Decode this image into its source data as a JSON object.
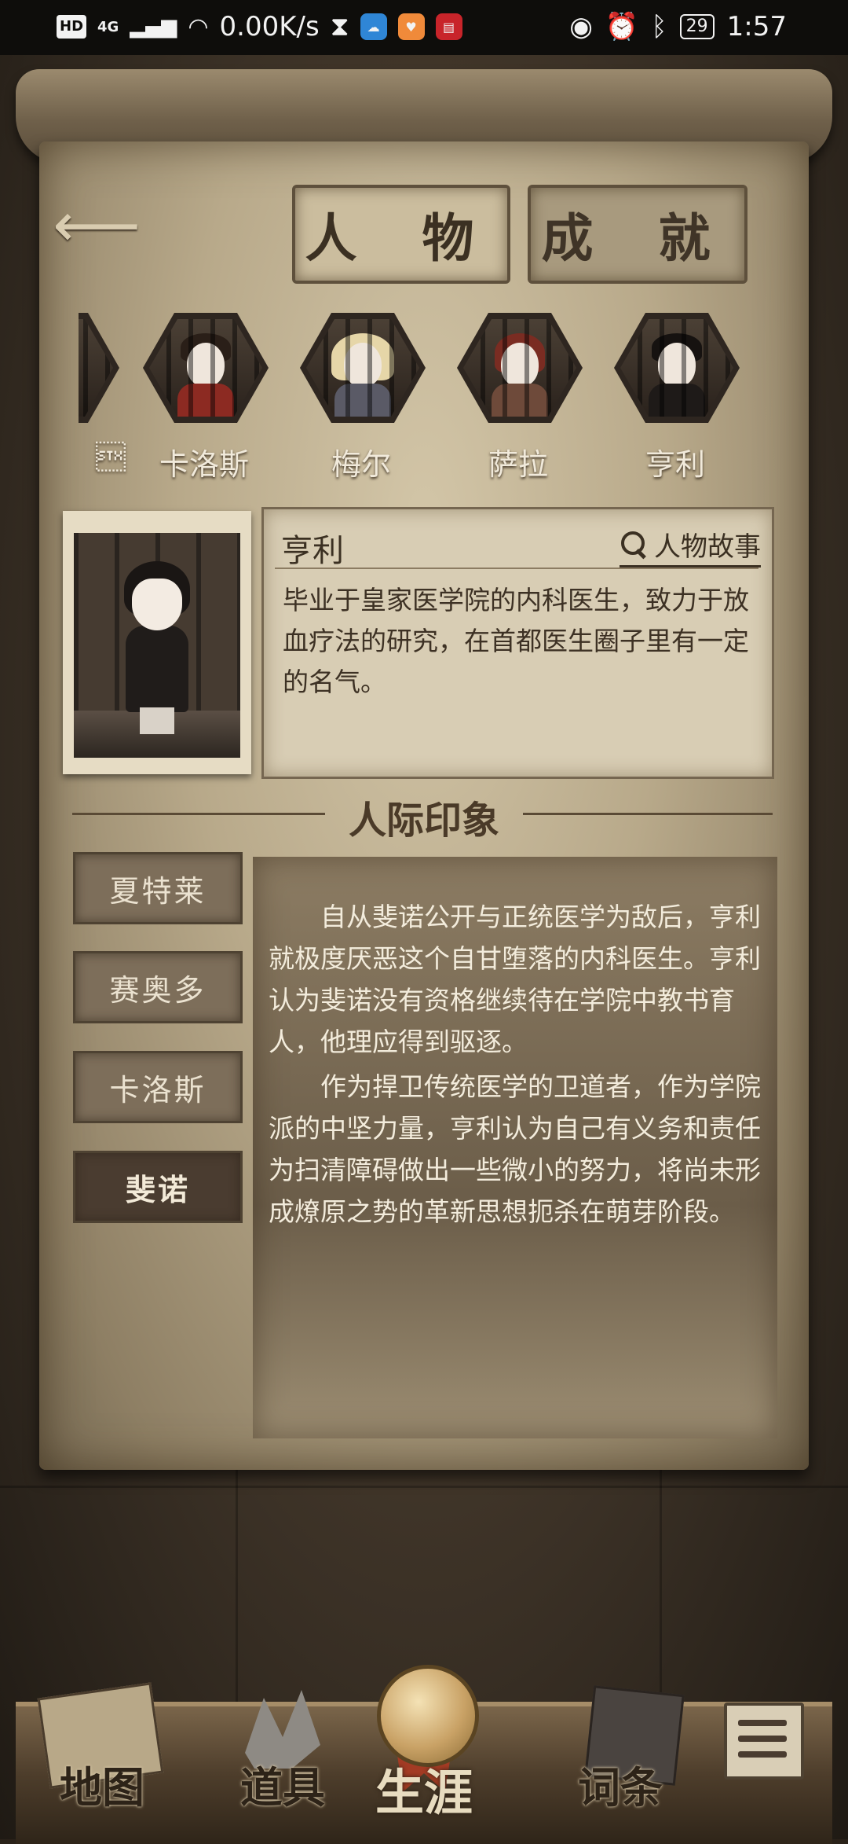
{
  "status_bar": {
    "hd": "HD",
    "network": "4G",
    "speed": "0.00K/s",
    "battery": "29",
    "time": "1:57"
  },
  "tabs": [
    {
      "label": "人 物",
      "active": true
    },
    {
      "label": "成 就",
      "active": false
    }
  ],
  "characters": [
    {
      "name": "\u0002",
      "partial": true
    },
    {
      "name": "卡洛斯"
    },
    {
      "name": "梅尔"
    },
    {
      "name": "萨拉"
    },
    {
      "name": "亨利",
      "selected": true
    }
  ],
  "profile": {
    "name": "亨利",
    "story_link": "人物故事",
    "description": "毕业于皇家医学院的内科医生，致力于放血疗法的研究，在首都医生圈子里有一定的名气。"
  },
  "relations": {
    "title": "人际印象",
    "items": [
      {
        "label": "夏特莱",
        "active": false
      },
      {
        "label": "赛奥多",
        "active": false
      },
      {
        "label": "卡洛斯",
        "active": false
      },
      {
        "label": "斐诺",
        "active": true
      }
    ],
    "paragraphs": [
      "自从斐诺公开与正统医学为敌后，亨利就极度厌恶这个自甘堕落的内科医生。亨利认为斐诺没有资格继续待在学院中教书育人，他理应得到驱逐。",
      "作为捍卫传统医学的卫道者，作为学院派的中坚力量，亨利认为自己有义务和责任为扫清障碍做出一些微小的努力，将尚未形成燎原之势的革新思想扼杀在萌芽阶段。"
    ]
  },
  "nav": {
    "map": "地图",
    "items": "道具",
    "career": "生涯",
    "glossary": "词条"
  },
  "colors": {
    "parchment": "#cbbd9e",
    "ink": "#3b3022",
    "active_tab": "#4a3c30"
  }
}
